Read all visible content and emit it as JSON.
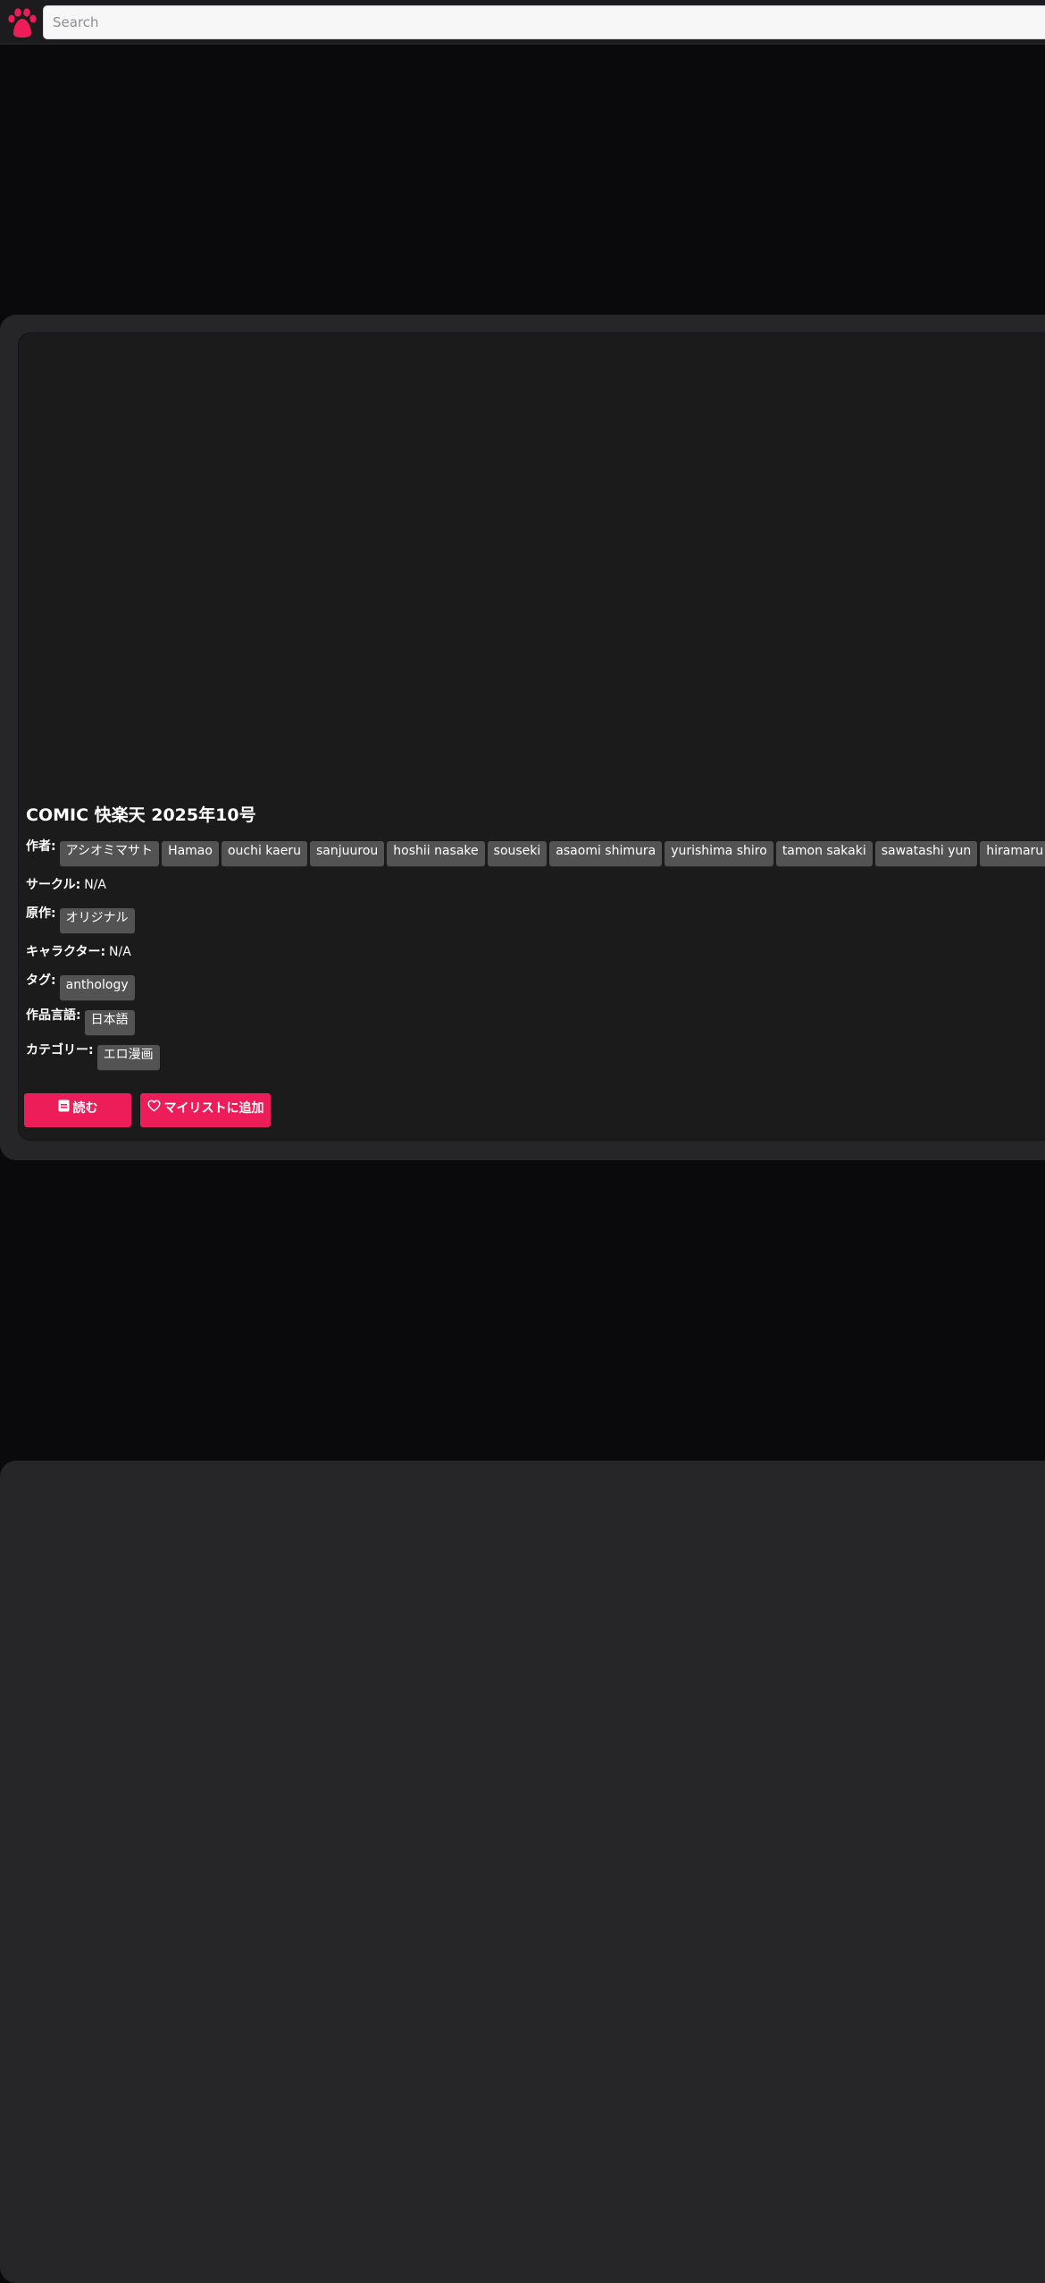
{
  "header": {
    "logo_icon": "paw-icon",
    "brand_color": "#ec1d59",
    "search_placeholder": "Search"
  },
  "gallery": {
    "title": "COMIC 快楽天 2025年10号",
    "authors_label": "作者:",
    "authors": [
      "アシオミマサト",
      "Hamao",
      "ouchi kaeru",
      "sanjuurou",
      "hoshii nasake",
      "souseki",
      "asaomi shimura",
      "yurishima shiro",
      "tamon sakaki",
      "sawatashi yun",
      "hiramaru"
    ],
    "circle_label": "サークル:",
    "circle_value": "N/A",
    "parody_label": "原作:",
    "parodies": [
      "オリジナル"
    ],
    "characters_label": "キャラクター:",
    "characters_value": "N/A",
    "tags_label": "タグ:",
    "tags": [
      "anthology"
    ],
    "language_label": "作品言語:",
    "languages": [
      "日本語"
    ],
    "category_label": "カテゴリー:",
    "categories": [
      "エロ漫画"
    ]
  },
  "actions": {
    "read_label": "読む",
    "read_icon": "book-icon",
    "mylist_label": "マイリストに追加",
    "mylist_icon": "heart-icon"
  }
}
